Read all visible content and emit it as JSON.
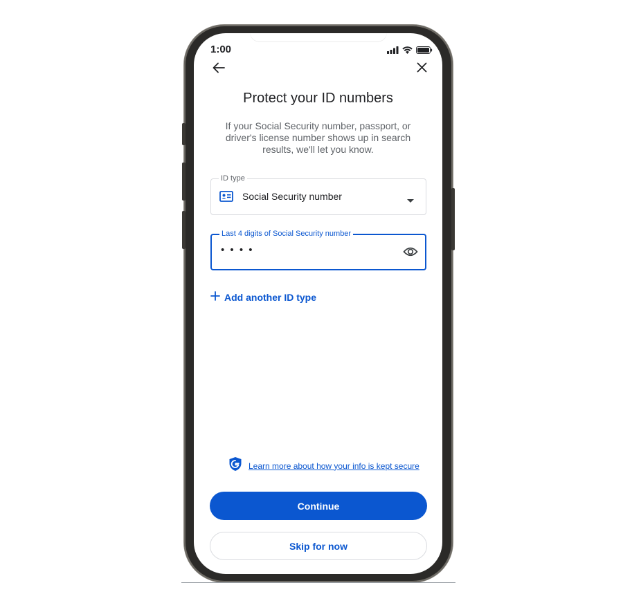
{
  "status_bar": {
    "time": "1:00",
    "icons": [
      "signal-icon",
      "wifi-icon",
      "battery-icon"
    ]
  },
  "header": {
    "back_icon": "arrow-left-icon",
    "close_icon": "close-icon"
  },
  "page": {
    "title": "Protect your ID numbers",
    "description": "If your Social Security number, passport, or driver's license number shows up in search results, we'll let you know."
  },
  "id_type_field": {
    "label": "ID type",
    "value": "Social Security number",
    "icon": "id-card-icon"
  },
  "digits_field": {
    "label": "Last 4 digits of Social Security number",
    "value": "• • • •",
    "icon": "eye-icon"
  },
  "add_id_link": {
    "label": "Add another ID type"
  },
  "security": {
    "link_text": "Learn more about how your info is kept secure",
    "icon": "google-shield-icon"
  },
  "actions": {
    "continue_label": "Continue",
    "skip_label": "Skip for now"
  },
  "colors": {
    "accent": "#0b57d0",
    "text_primary": "#202124",
    "text_secondary": "#5f6368",
    "border": "#dadce0",
    "frame": "#2b2a28"
  }
}
